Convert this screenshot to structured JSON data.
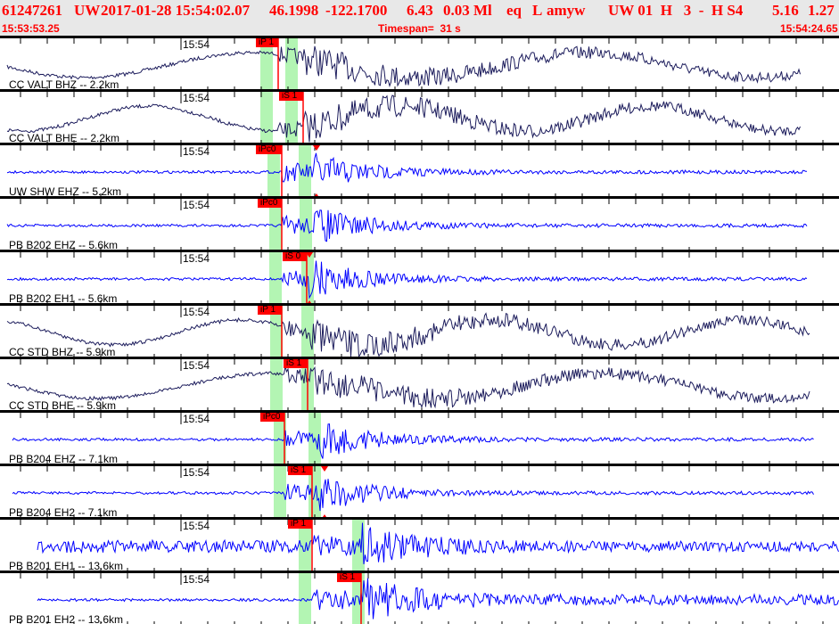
{
  "header": {
    "event_id": "61247261",
    "network": "UW",
    "origin": "2017-01-28 15:54:02.07",
    "lat": "46.1998",
    "lon": "-122.1700",
    "depth": "6.43",
    "magnitude": "0.03 Ml",
    "etype": "eq",
    "gtype": "L",
    "analyst": "amyw",
    "sub": "UW 01  H   3  -  H S4",
    "v1": "5.16",
    "v2": "1.27",
    "start_time": "15:53:53.25",
    "timespan": "Timespan=  31 s",
    "end_time": "15:54:24.65"
  },
  "colors": {
    "pick": "#ff0000",
    "window": "#b3f5b3",
    "trace_bb": "#1c1c5c",
    "trace_sp": "#0000ff"
  },
  "panels": [
    {
      "station": "CC VALT BHZ -- 2.2km",
      "time_label": "15:54",
      "pick": "iP 1"
    },
    {
      "station": "CC VALT BHE -- 2.2km",
      "time_label": "15:54",
      "pick": "iS 1"
    },
    {
      "station": "UW SHW EHZ -- 5.2km",
      "time_label": "15:54",
      "pick": "iPc0"
    },
    {
      "station": "PB B202 EHZ -- 5.6km",
      "time_label": "15:54",
      "pick": "iPc0"
    },
    {
      "station": "PB B202 EH1 -- 5.6km",
      "time_label": "15:54",
      "pick": "iS 0"
    },
    {
      "station": "CC STD BHZ -- 5.9km",
      "time_label": "15:54",
      "pick": "iP 1"
    },
    {
      "station": "CC STD BHE -- 5.9km",
      "time_label": "15:54",
      "pick": "iS 1"
    },
    {
      "station": "PB B204 EHZ -- 7.1km",
      "time_label": "15:54",
      "pick": "iPc0"
    },
    {
      "station": "PB B204 EH2 -- 7.1km",
      "time_label": "15:54",
      "pick": "iS 1"
    },
    {
      "station": "PB B201 EH1 -- 13.6km",
      "time_label": "15:54",
      "pick": "iP 1"
    },
    {
      "station": "PB B201 EH2 -- 13.6km",
      "time_label": "15:54",
      "pick": "iS 1"
    }
  ]
}
